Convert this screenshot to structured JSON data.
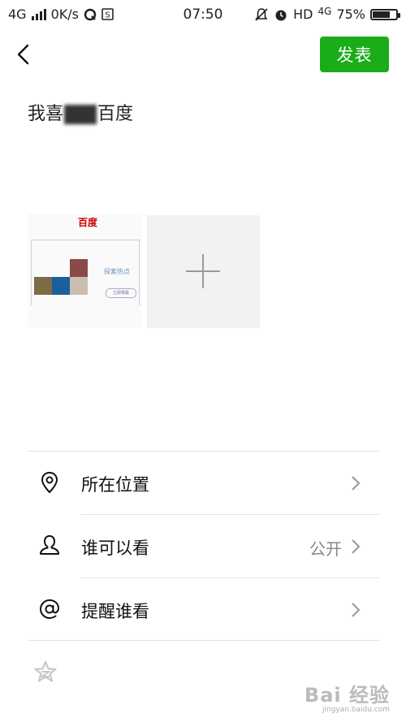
{
  "status_bar": {
    "network_left": "4G",
    "speed": "0K/s",
    "time": "07:50",
    "hd": "HD",
    "network_right": "4G",
    "battery_text": "75%",
    "battery_level": 0.75
  },
  "header": {
    "publish_label": "发表"
  },
  "post": {
    "text_before": "我喜",
    "text_after": "百度"
  },
  "thumbnail": {
    "logo_text": "百度",
    "caption": "探索热点",
    "button": "立即观看"
  },
  "menu": [
    {
      "label": "所在位置",
      "value": "",
      "icon": "location-pin-icon"
    },
    {
      "label": "谁可以看",
      "value": "公开",
      "icon": "person-icon"
    },
    {
      "label": "提醒谁看",
      "value": "",
      "icon": "at-sign-icon"
    }
  ],
  "colors": {
    "accent": "#1aad19",
    "muted": "#888888"
  },
  "watermark": {
    "brand": "Bai 经验",
    "url": "jingyan.baidu.com"
  }
}
